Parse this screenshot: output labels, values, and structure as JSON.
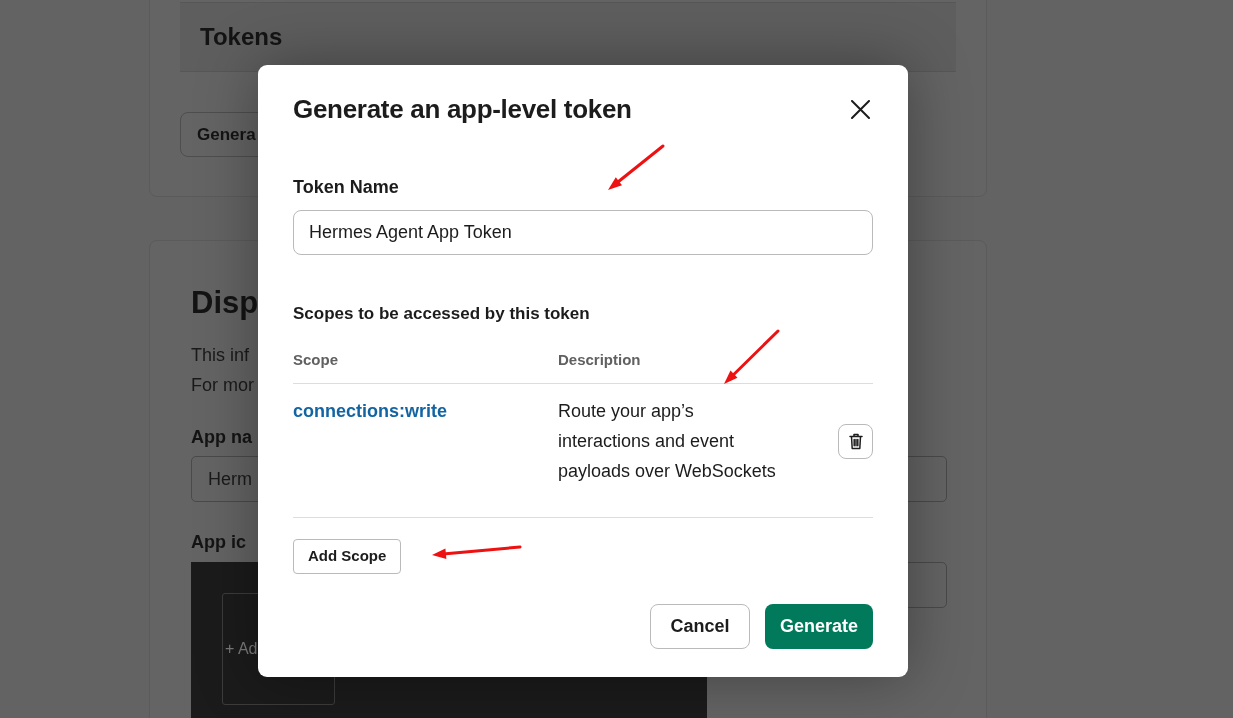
{
  "background_page": {
    "tokens_section": {
      "heading": "Tokens",
      "button": "Genera"
    },
    "display_section": {
      "heading": "Disp",
      "lines": [
        "This inf",
        "For mor"
      ],
      "app_name": {
        "label": "App na",
        "value": "Herm"
      },
      "app_icon": {
        "label": "App ic",
        "upload_label": "+ Ad"
      }
    }
  },
  "dialog": {
    "title": "Generate an app-level token",
    "token_name": {
      "label": "Token Name",
      "value": "Hermes Agent App Token"
    },
    "scopes": {
      "heading": "Scopes to be accessed by this token",
      "columns": [
        "Scope",
        "Description"
      ],
      "rows": [
        {
          "scope": "connections:write",
          "description": "Route your app’s interactions and event payloads over WebSockets"
        }
      ],
      "add_button": "Add Scope"
    },
    "buttons": [
      {
        "label": "Cancel",
        "kind": "secondary"
      },
      {
        "label": "Generate",
        "kind": "primary"
      }
    ]
  }
}
